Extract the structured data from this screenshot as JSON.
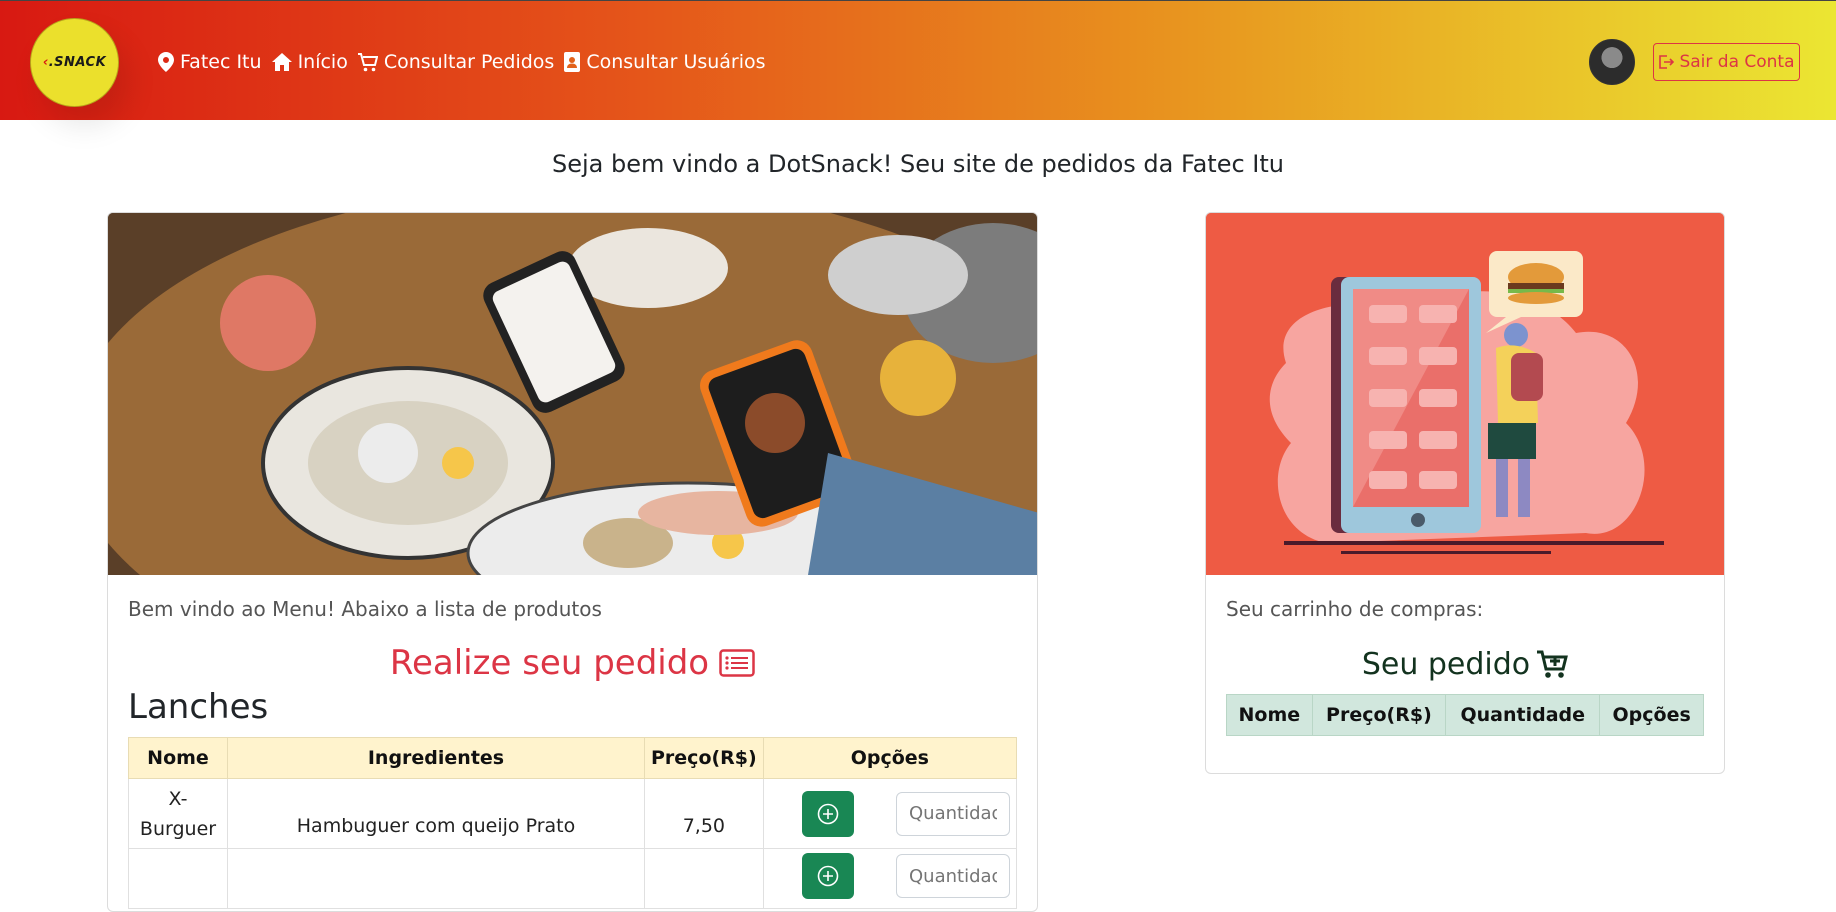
{
  "navbar": {
    "logo_text": "SNACK",
    "links": [
      {
        "label": "Fatec Itu",
        "icon": "location-pin-icon"
      },
      {
        "label": "Início",
        "icon": "home-icon"
      },
      {
        "label": "Consultar Pedidos",
        "icon": "cart-icon"
      },
      {
        "label": "Consultar Usuários",
        "icon": "user-badge-icon"
      }
    ],
    "logout_label": "Sair da Conta"
  },
  "welcome_text": "Seja bem vindo a DotSnack! Seu site de pedidos da Fatec Itu",
  "menu_card": {
    "subtitle": "Bem vindo ao Menu! Abaixo a lista de produtos",
    "heading": "Realize seu pedido",
    "section_title": "Lanches",
    "table": {
      "headers": [
        "Nome",
        "Ingredientes",
        "Preço(R$)",
        "Opções"
      ],
      "rows": [
        {
          "name": "X-Burguer",
          "ingredients": "Hambuguer com queijo Prato",
          "price": "7,50",
          "qty_placeholder": "Quantidade"
        },
        {
          "name": "",
          "ingredients": "",
          "price": "",
          "qty_placeholder": "Quantidade"
        }
      ]
    }
  },
  "cart_card": {
    "subtitle": "Seu carrinho de compras:",
    "heading": "Seu pedido",
    "table": {
      "headers": [
        "Nome",
        "Preço(R$)",
        "Quantidade",
        "Opções"
      ]
    }
  },
  "colors": {
    "danger": "#dc3545",
    "success": "#198754",
    "warning_light": "#fff3cd",
    "success_light": "#d1e7dd"
  }
}
